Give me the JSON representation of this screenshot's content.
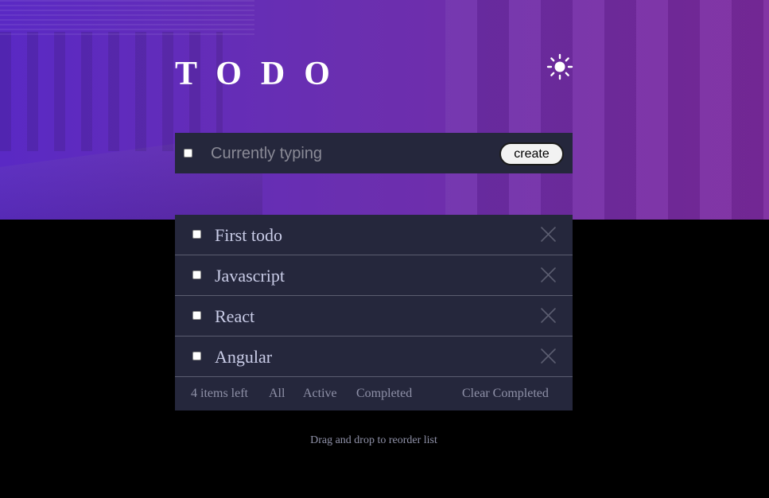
{
  "header": {
    "title": "TODO",
    "theme_toggle_icon": "sun-icon"
  },
  "create": {
    "placeholder": "Currently typing",
    "button_label": "create"
  },
  "todos": [
    {
      "text": "First todo",
      "completed": false
    },
    {
      "text": "Javascript",
      "completed": false
    },
    {
      "text": "React",
      "completed": false
    },
    {
      "text": "Angular",
      "completed": false
    }
  ],
  "footer": {
    "items_left": "4 items left",
    "filter_all": "All",
    "filter_active": "Active",
    "filter_completed": "Completed",
    "clear_completed": "Clear Completed"
  },
  "hint": "Drag and drop to reorder list",
  "colors": {
    "page_background": "#000000",
    "card_background": "#25273c",
    "todo_text": "#cacde8",
    "muted_text": "#8f91a8",
    "gradient_start": "#5a29c4",
    "gradient_end": "#7c2a9f"
  }
}
